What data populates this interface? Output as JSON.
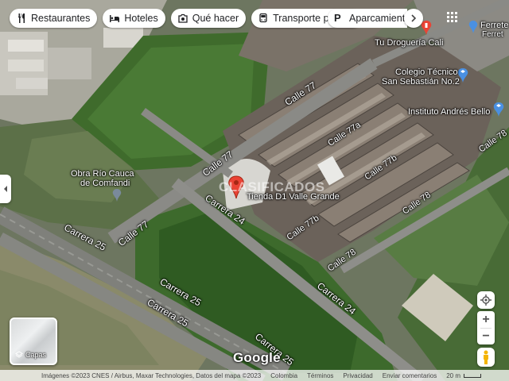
{
  "chips": [
    {
      "label": "Restaurantes",
      "icon": "fork-knife-icon"
    },
    {
      "label": "Hoteles",
      "icon": "bed-icon"
    },
    {
      "label": "Qué hacer",
      "icon": "camera-icon"
    },
    {
      "label": "Transporte público",
      "icon": "bus-icon"
    },
    {
      "label": "Aparcamientos",
      "icon": "parking-icon"
    }
  ],
  "map_labels": {
    "calle77_a": "Calle 77",
    "calle77_b": "Calle 77",
    "calle77_c": "Calle 77",
    "calle77a": "Calle 77a",
    "calle77b_a": "Calle 77b",
    "calle77b_b": "Calle 77b",
    "calle78_a": "Calle 78",
    "calle78_b": "Calle 78",
    "calle78_c": "Calle 78",
    "carrera24_a": "Carrera 24",
    "carrera24_b": "Carrera 24",
    "carrera25_a": "Carrera 25",
    "carrera25_b": "Carrera 25",
    "carrera25_c": "Carrera 25",
    "carrera25_d": "Carrera 25"
  },
  "pois": {
    "drogueria": "Tu Droguería Cali",
    "colegio_l1": "Colegio Técnico",
    "colegio_l2": "San Sebastián No.2",
    "instituto": "Instituto Andrés Bello",
    "obra_l1": "Obra Río Cauca",
    "obra_l2": "de Comfandi",
    "tienda": "Tienda D1 Valle Grande",
    "ferreteria": "Ferrete",
    "ferreteria2": "Ferret"
  },
  "watermark": "CLASIFICADOS",
  "layers_label": "Capas",
  "google_logo": "Google",
  "footer": {
    "attribution": "Imágenes ©2023 CNES / Airbus, Maxar Technologies, Datos del mapa ©2023",
    "country": "Colombia",
    "terms": "Términos",
    "privacy": "Privacidad",
    "feedback": "Enviar comentarios",
    "scale": "20 m"
  },
  "colors": {
    "marker": "#ea4335",
    "poi_blue": "#4a90e2",
    "grass": "#4f7a3a",
    "road": "#8a8a86"
  }
}
